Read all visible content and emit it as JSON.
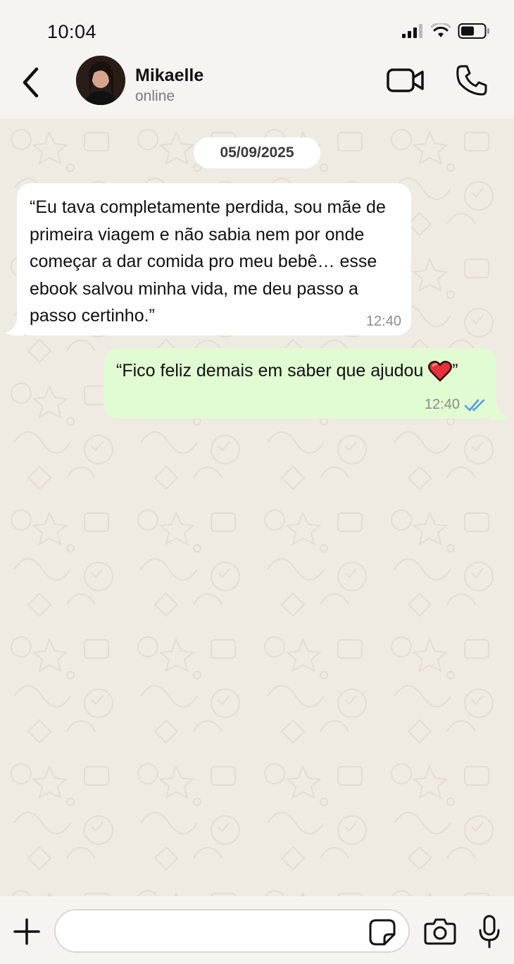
{
  "status_bar": {
    "time": "10:04"
  },
  "header": {
    "contact_name": "Mikaelle",
    "contact_status": "online"
  },
  "chat": {
    "date": "05/09/2025",
    "messages": [
      {
        "direction": "incoming",
        "text": "“Eu tava completamente perdida, sou mãe de primeira viagem e não sabia nem por onde começar a dar comida pro meu bebê… esse ebook salvou minha vida, me deu passo a passo certinho.”",
        "time": "12:40"
      },
      {
        "direction": "outgoing",
        "text_before_emoji": "“Fico feliz demais em saber que ajudou ",
        "emoji": "heart-emoji",
        "text_after_emoji": "”",
        "time": "12:40",
        "status": "read"
      }
    ]
  },
  "input": {
    "placeholder": ""
  },
  "colors": {
    "header_bg": "#f5f4f1",
    "chat_bg": "#efeae2",
    "incoming_bubble": "#ffffff",
    "outgoing_bubble": "#e1fbd2",
    "read_ticks": "#4a9ee8"
  }
}
